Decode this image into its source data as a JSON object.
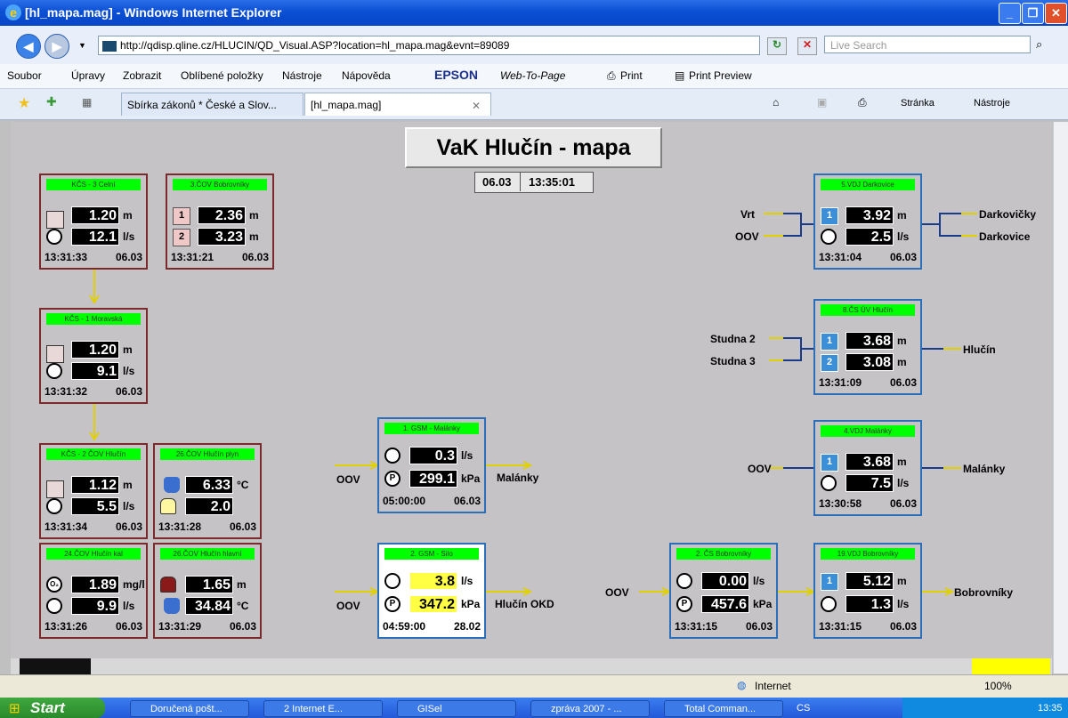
{
  "window": {
    "title": "[hl_mapa.mag] - Windows Internet Explorer"
  },
  "address": {
    "url": "http://qdisp.qline.cz/HLUCIN/QD_Visual.ASP?location=hl_mapa.mag&evnt=89089",
    "search_placeholder": "Live Search"
  },
  "menu": {
    "items": [
      "Soubor",
      "Úpravy",
      "Zobrazit",
      "Oblíbené položky",
      "Nástroje",
      "Nápověda"
    ],
    "epson": "EPSON",
    "web_to_page": "Web-To-Page",
    "print": "Print",
    "print_preview": "Print Preview"
  },
  "tabs": {
    "tab1": "Sbírka zákonů * České a Slov...",
    "tab2": "[hl_mapa.mag]",
    "page_btn": "Stránka",
    "tools_btn": "Nástroje"
  },
  "map": {
    "title": "VaK Hlučín - mapa",
    "date": "06.03",
    "time": "13:35:01"
  },
  "stations": {
    "kcs3": {
      "name": "KČS - 3 Celní",
      "v1": "1.20",
      "u1": "m",
      "v2": "12.1",
      "u2": "l/s",
      "time": "13:31:33",
      "date": "06.03"
    },
    "cov_bob": {
      "name": "3.ČOV Bobrovníky",
      "n1": "1",
      "v1": "2.36",
      "u1": "m",
      "n2": "2",
      "v2": "3.23",
      "u2": "m",
      "time": "13:31:21",
      "date": "06.03"
    },
    "kcs1": {
      "name": "KČS - 1 Moravská",
      "v1": "1.20",
      "u1": "m",
      "v2": "9.1",
      "u2": "l/s",
      "time": "13:31:32",
      "date": "06.03"
    },
    "kcs2": {
      "name": "KČS - 2 ČOV Hlučín",
      "v1": "1.12",
      "u1": "m",
      "v2": "5.5",
      "u2": "l/s",
      "time": "13:31:34",
      "date": "06.03"
    },
    "cov_plyn": {
      "name": "26.ČOV Hlučín plyn",
      "v1": "6.33",
      "u1": "°C",
      "v2": "2.0",
      "time": "13:31:28",
      "date": "06.03"
    },
    "cov_kal": {
      "name": "24.ČOV Hlučín kal",
      "o2": "O₂",
      "v1": "1.89",
      "u1": "mg/l",
      "v2": "9.9",
      "u2": "l/s",
      "time": "13:31:26",
      "date": "06.03"
    },
    "cov_hlavni": {
      "name": "26.ČOV Hlučín hlavní",
      "v1": "1.65",
      "u1": "m",
      "v2": "34.84",
      "u2": "°C",
      "time": "13:31:29",
      "date": "06.03"
    },
    "gsm_mal": {
      "name": "1. GSM - Malánky",
      "v1": "0.3",
      "u1": "l/s",
      "p": "P",
      "v2": "299.1",
      "u2": "kPa",
      "time": "05:00:00",
      "date": "06.03"
    },
    "gsm_silo": {
      "name": "2. GSM - Silo",
      "v1": "3.8",
      "u1": "l/s",
      "p": "P",
      "v2": "347.2",
      "u2": "kPa",
      "time": "04:59:00",
      "date": "28.02"
    },
    "cs_bob": {
      "name": "2. ČS Bobrovníky",
      "v1": "0.00",
      "u1": "l/s",
      "p": "P",
      "v2": "457.6",
      "u2": "kPa",
      "time": "13:31:15",
      "date": "06.03"
    },
    "vdj_dark": {
      "name": "5.VDJ Darkovice",
      "n1": "1",
      "v1": "3.92",
      "u1": "m",
      "v2": "2.5",
      "u2": "l/s",
      "time": "13:31:04",
      "date": "06.03"
    },
    "cs_uv": {
      "name": "8.ČS ÚV Hlučín",
      "n1": "1",
      "v1": "3.68",
      "u1": "m",
      "n2": "2",
      "v2": "3.08",
      "u2": "m",
      "time": "13:31:09",
      "date": "06.03"
    },
    "vdj_mal": {
      "name": "4.VDJ Malánky",
      "n1": "1",
      "v1": "3.68",
      "u1": "m",
      "v2": "7.5",
      "u2": "l/s",
      "time": "13:30:58",
      "date": "06.03"
    },
    "vdj_bob": {
      "name": "19.VDJ Bobrovníky",
      "n1": "1",
      "v1": "5.12",
      "u1": "m",
      "v2": "1.3",
      "u2": "l/s",
      "time": "13:31:15",
      "date": "06.03"
    }
  },
  "labels": {
    "vrt": "Vrt",
    "oov": "OOV",
    "darkovicky": "Darkovičky",
    "darkovice": "Darkovice",
    "studna2": "Studna 2",
    "studna3": "Studna 3",
    "hlucin": "Hlučín",
    "malanky": "Malánky",
    "hlucin_okd": "Hlučín OKD",
    "bobrovniky": "Bobrovníky"
  },
  "status": {
    "zone": "Internet",
    "zoom": "100%"
  },
  "taskbar": {
    "start": "Start",
    "items": [
      "Doručená pošt...",
      "2 Internet E...",
      "GISel",
      "zpráva 2007 - ...",
      "Total Comman..."
    ],
    "lang": "CS",
    "clock": "13:35"
  }
}
